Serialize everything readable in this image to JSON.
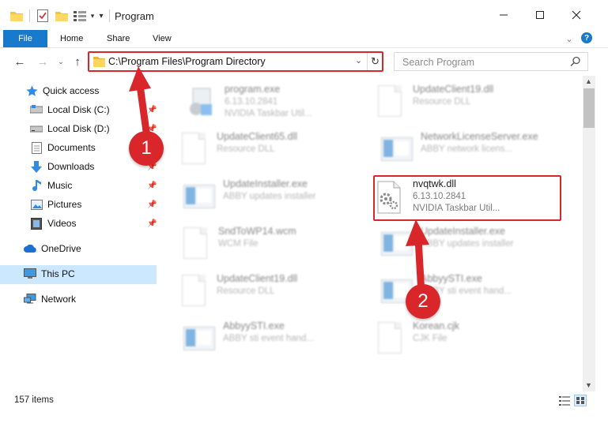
{
  "window": {
    "title": "Program",
    "controls": [
      "minimize",
      "maximize",
      "close"
    ]
  },
  "ribbon": {
    "file": "File",
    "tabs": [
      "Home",
      "Share",
      "View"
    ]
  },
  "nav": {
    "address": "C:\\Program Files\\Program Directory",
    "search_placeholder": "Search Program"
  },
  "sidebar": {
    "items": [
      {
        "label": "Quick access",
        "icon": "star-icon"
      },
      {
        "label": "Local Disk (C:)",
        "icon": "drive-icon"
      },
      {
        "label": "Local Disk (D:)",
        "icon": "drive-icon"
      },
      {
        "label": "Documents",
        "icon": "documents-icon"
      },
      {
        "label": "Downloads",
        "icon": "download-icon"
      },
      {
        "label": "Music",
        "icon": "music-icon"
      },
      {
        "label": "Pictures",
        "icon": "pictures-icon"
      },
      {
        "label": "Videos",
        "icon": "videos-icon"
      },
      {
        "label": "OneDrive",
        "icon": "cloud-icon"
      },
      {
        "label": "This PC",
        "icon": "computer-icon"
      },
      {
        "label": "Network",
        "icon": "network-icon"
      }
    ]
  },
  "files": [
    {
      "name": "program.exe",
      "line1": "6.13.10.2841",
      "line2": "NVIDIA Taskbar Util...",
      "thumb": "exe"
    },
    {
      "name": "UpdateClient19.dll",
      "line1": "Resource DLL",
      "line2": "",
      "thumb": "gear"
    },
    {
      "name": "UpdateClient65.dll",
      "line1": "Resource DLL",
      "line2": "",
      "thumb": "gear"
    },
    {
      "name": "NetworkLicenseServer.exe",
      "line1": "ABBY network licens...",
      "line2": "",
      "thumb": "window"
    },
    {
      "name": "UpdateInstaller.exe",
      "line1": "ABBY updates installer",
      "line2": "",
      "thumb": "window"
    },
    {
      "name": "nvqtwk.dll",
      "line1": "6.13.10.2841",
      "line2": "NVIDIA Taskbar Util...",
      "thumb": "gear"
    },
    {
      "name": "SndToWP14.wcm",
      "line1": "WCM File",
      "line2": "",
      "thumb": "doc"
    },
    {
      "name": "UpdateInstaller.exe",
      "line1": "ABBY updates installer",
      "line2": "",
      "thumb": "window"
    },
    {
      "name": "UpdateClient19.dll",
      "line1": "Resource DLL",
      "line2": "",
      "thumb": "gear"
    },
    {
      "name": "AbbyySTI.exe",
      "line1": "ABBY sti event hand...",
      "line2": "",
      "thumb": "window"
    },
    {
      "name": "AbbyySTI.exe",
      "line1": "ABBY sti event hand...",
      "line2": "",
      "thumb": "window"
    },
    {
      "name": "Korean.cjk",
      "line1": "CJK File",
      "line2": "",
      "thumb": "doc"
    }
  ],
  "status": {
    "count": "157 items"
  },
  "callouts": [
    "1",
    "2"
  ],
  "colors": {
    "accent": "#1979ca",
    "highlight": "#d9262b",
    "selection": "#cce8ff"
  }
}
